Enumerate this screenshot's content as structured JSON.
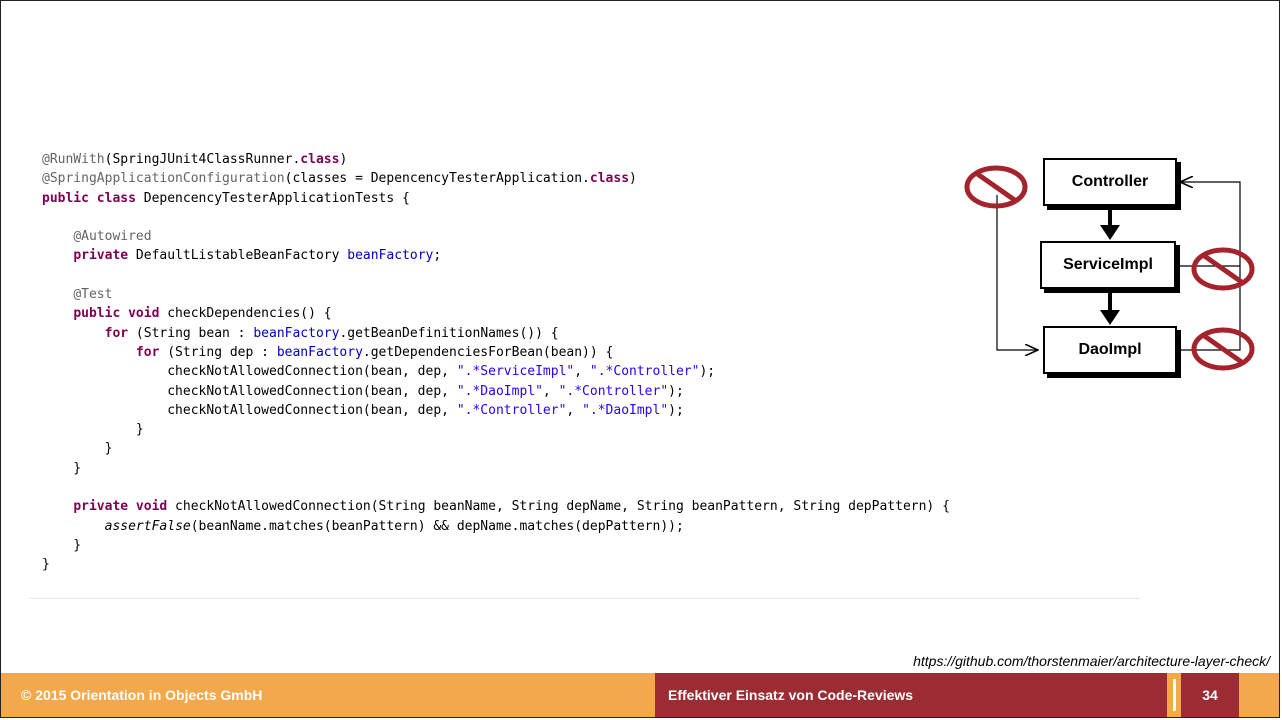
{
  "code": {
    "lines": [
      [
        {
          "c": "ann",
          "t": "@RunWith"
        },
        {
          "c": "pl",
          "t": "(SpringJUnit4ClassRunner."
        },
        {
          "c": "kw",
          "t": "class"
        },
        {
          "c": "pl",
          "t": ")"
        }
      ],
      [
        {
          "c": "ann",
          "t": "@SpringApplicationConfiguration"
        },
        {
          "c": "pl",
          "t": "(classes = DepencencyTesterApplication."
        },
        {
          "c": "kw",
          "t": "class"
        },
        {
          "c": "pl",
          "t": ")"
        }
      ],
      [
        {
          "c": "kw",
          "t": "public class"
        },
        {
          "c": "pl",
          "t": " DepencencyTesterApplicationTests {"
        }
      ],
      [],
      [
        {
          "c": "pl",
          "t": "    "
        },
        {
          "c": "ann",
          "t": "@Autowired"
        }
      ],
      [
        {
          "c": "pl",
          "t": "    "
        },
        {
          "c": "kw",
          "t": "private"
        },
        {
          "c": "pl",
          "t": " DefaultListableBeanFactory "
        },
        {
          "c": "fld",
          "t": "beanFactory"
        },
        {
          "c": "pl",
          "t": ";"
        }
      ],
      [],
      [
        {
          "c": "pl",
          "t": "    "
        },
        {
          "c": "ann",
          "t": "@Test"
        }
      ],
      [
        {
          "c": "pl",
          "t": "    "
        },
        {
          "c": "kw",
          "t": "public void"
        },
        {
          "c": "pl",
          "t": " checkDependencies() {"
        }
      ],
      [
        {
          "c": "pl",
          "t": "        "
        },
        {
          "c": "kw",
          "t": "for"
        },
        {
          "c": "pl",
          "t": " (String bean : "
        },
        {
          "c": "fld",
          "t": "beanFactory"
        },
        {
          "c": "pl",
          "t": ".getBeanDefinitionNames()) {"
        }
      ],
      [
        {
          "c": "pl",
          "t": "            "
        },
        {
          "c": "kw",
          "t": "for"
        },
        {
          "c": "pl",
          "t": " (String dep : "
        },
        {
          "c": "fld",
          "t": "beanFactory"
        },
        {
          "c": "pl",
          "t": ".getDependenciesForBean(bean)) {"
        }
      ],
      [
        {
          "c": "pl",
          "t": "                checkNotAllowedConnection(bean, dep, "
        },
        {
          "c": "str",
          "t": "\".*ServiceImpl\""
        },
        {
          "c": "pl",
          "t": ", "
        },
        {
          "c": "str",
          "t": "\".*Controller\""
        },
        {
          "c": "pl",
          "t": ");"
        }
      ],
      [
        {
          "c": "pl",
          "t": "                checkNotAllowedConnection(bean, dep, "
        },
        {
          "c": "str",
          "t": "\".*DaoImpl\""
        },
        {
          "c": "pl",
          "t": ", "
        },
        {
          "c": "str",
          "t": "\".*Controller\""
        },
        {
          "c": "pl",
          "t": ");"
        }
      ],
      [
        {
          "c": "pl",
          "t": "                checkNotAllowedConnection(bean, dep, "
        },
        {
          "c": "str",
          "t": "\".*Controller\""
        },
        {
          "c": "pl",
          "t": ", "
        },
        {
          "c": "str",
          "t": "\".*DaoImpl\""
        },
        {
          "c": "pl",
          "t": ");"
        }
      ],
      [
        {
          "c": "pl",
          "t": "            }"
        }
      ],
      [
        {
          "c": "pl",
          "t": "        }"
        }
      ],
      [
        {
          "c": "pl",
          "t": "    }"
        }
      ],
      [],
      [
        {
          "c": "pl",
          "t": "    "
        },
        {
          "c": "kw",
          "t": "private void"
        },
        {
          "c": "pl",
          "t": " checkNotAllowedConnection(String beanName, String depName, String beanPattern, String depPattern) {"
        }
      ],
      [
        {
          "c": "pl",
          "t": "        "
        },
        {
          "c": "it",
          "t": "assertFalse"
        },
        {
          "c": "pl",
          "t": "(beanName.matches(beanPattern) && depName.matches(depPattern));"
        }
      ],
      [
        {
          "c": "pl",
          "t": "    }"
        }
      ],
      [
        {
          "c": "pl",
          "t": "}"
        }
      ]
    ]
  },
  "diagram": {
    "controller_label": "Controller",
    "service_label": "ServiceImpl",
    "dao_label": "DaoImpl",
    "forbidden_color": "#a3242c"
  },
  "source_url": "https://github.com/thorstenmaier/architecture-layer-check/",
  "footer": {
    "copyright": "© 2015 Orientation in Objects GmbH",
    "talk_title": "Effektiver Einsatz von Code-Reviews",
    "page_number": "34",
    "background_color": "#f4a84c",
    "accent_color": "#9b2c33"
  }
}
